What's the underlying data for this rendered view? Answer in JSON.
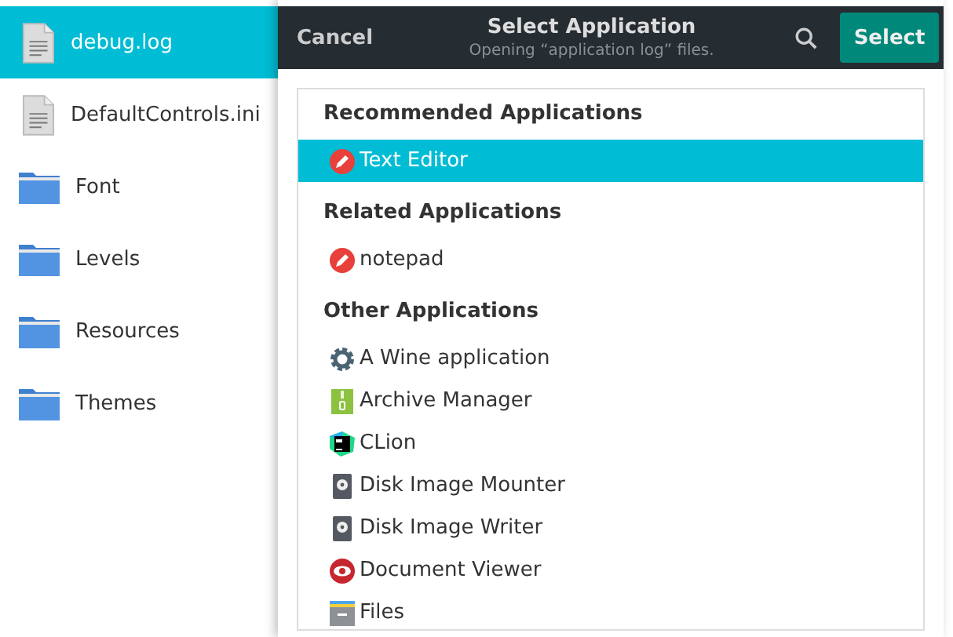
{
  "files": [
    {
      "name": "debug.log",
      "kind": "file",
      "selected": true
    },
    {
      "name": "DefaultControls.ini",
      "kind": "file",
      "selected": false
    },
    {
      "name": "Font",
      "kind": "folder",
      "selected": false
    },
    {
      "name": "Levels",
      "kind": "folder",
      "selected": false
    },
    {
      "name": "Resources",
      "kind": "folder",
      "selected": false
    },
    {
      "name": "Themes",
      "kind": "folder",
      "selected": false
    }
  ],
  "dialog": {
    "cancel": "Cancel",
    "title": "Select Application",
    "subtitle": "Opening “application log” files.",
    "confirm": "Select",
    "sections": [
      {
        "title": "Recommended Applications",
        "apps": [
          {
            "name": "Text Editor",
            "kind": "pencil",
            "selected": true
          }
        ]
      },
      {
        "title": "Related Applications",
        "apps": [
          {
            "name": "notepad",
            "kind": "pencil",
            "selected": false
          }
        ]
      },
      {
        "title": "Other Applications",
        "apps": [
          {
            "name": "A Wine application",
            "kind": "gear",
            "selected": false
          },
          {
            "name": "Archive Manager",
            "kind": "archive",
            "selected": false
          },
          {
            "name": "CLion",
            "kind": "ide",
            "selected": false
          },
          {
            "name": "Disk Image Mounter",
            "kind": "disk",
            "selected": false
          },
          {
            "name": "Disk Image Writer",
            "kind": "disk",
            "selected": false
          },
          {
            "name": "Document Viewer",
            "kind": "eye",
            "selected": false
          },
          {
            "name": "Files",
            "kind": "drawer",
            "selected": false
          }
        ]
      }
    ]
  }
}
